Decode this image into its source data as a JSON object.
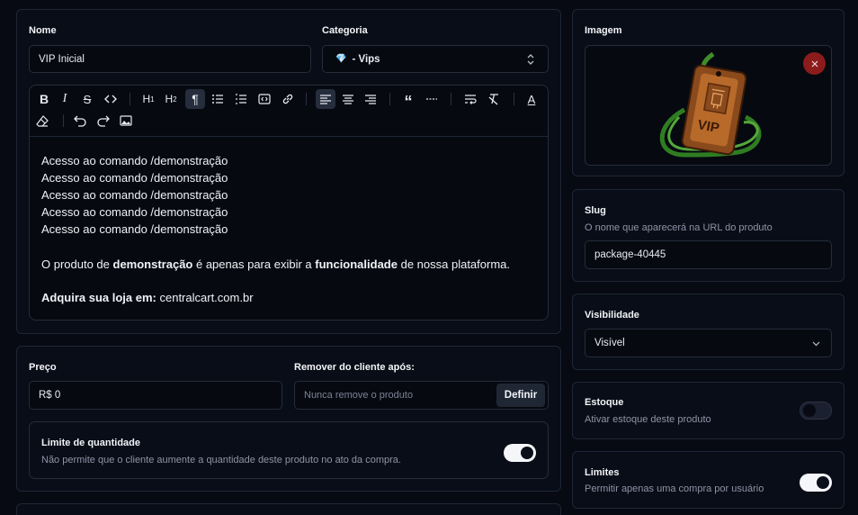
{
  "product": {
    "name_label": "Nome",
    "name_value": "VIP Inicial",
    "category_label": "Categoria",
    "category_icon": "💎",
    "category_value": "- Vips"
  },
  "editor": {
    "toolbar": [
      "bold-icon",
      "italic-icon",
      "strikethrough-icon",
      "code-icon",
      "heading-1-icon",
      "heading-2-icon",
      "paragraph-icon",
      "bullet-list-icon",
      "ordered-list-icon",
      "code-block-icon",
      "link-icon",
      "align-left-icon",
      "align-center-icon",
      "align-right-icon",
      "blockquote-icon",
      "horizontal-rule-icon",
      "wrap-text-icon",
      "clear-format-icon",
      "text-color-icon",
      "eraser-icon",
      "undo-icon",
      "redo-icon",
      "image-icon"
    ],
    "lines": [
      "Acesso ao comando /demonstração",
      "Acesso ao comando /demonstração",
      "Acesso ao comando /demonstração",
      "Acesso ao comando /demonstração",
      "Acesso ao comando /demonstração"
    ],
    "para_prefix": "O produto de ",
    "para_bold1": "demonstração",
    "para_mid": " é apenas para exibir a ",
    "para_bold2": "funcionalidade",
    "para_suffix": " de nossa plataforma.",
    "store_bold": "Adquira sua loja em:",
    "store_url": " centralcart.com.br"
  },
  "pricing": {
    "price_label": "Preço",
    "price_value": "R$ 0",
    "remove_label": "Remover do cliente após:",
    "remove_placeholder": "Nunca remove o produto",
    "define_button": "Definir",
    "limit_title": "Limite de quantidade",
    "limit_desc": "Não permite que o cliente aumente a quantidade deste produto no ato da compra.",
    "limit_enabled": true
  },
  "image": {
    "label": "Imagem",
    "remove_icon": "close-icon",
    "tag_text": "VIP"
  },
  "slug": {
    "label": "Slug",
    "desc": "O nome que aparecerá na URL do produto",
    "value": "package-40445"
  },
  "visibility": {
    "label": "Visibilidade",
    "value": "Visível"
  },
  "stock": {
    "label": "Estoque",
    "desc": "Ativar estoque deste produto",
    "enabled": false
  },
  "limits": {
    "label": "Limites",
    "desc": "Permitir apenas uma compra por usuário",
    "enabled": true
  },
  "colors": {
    "background": "#070a12",
    "card": "#090d17",
    "border": "#1f2635",
    "remove_button": "#8c1c1c",
    "toggle_on": "#f4f6fa"
  }
}
